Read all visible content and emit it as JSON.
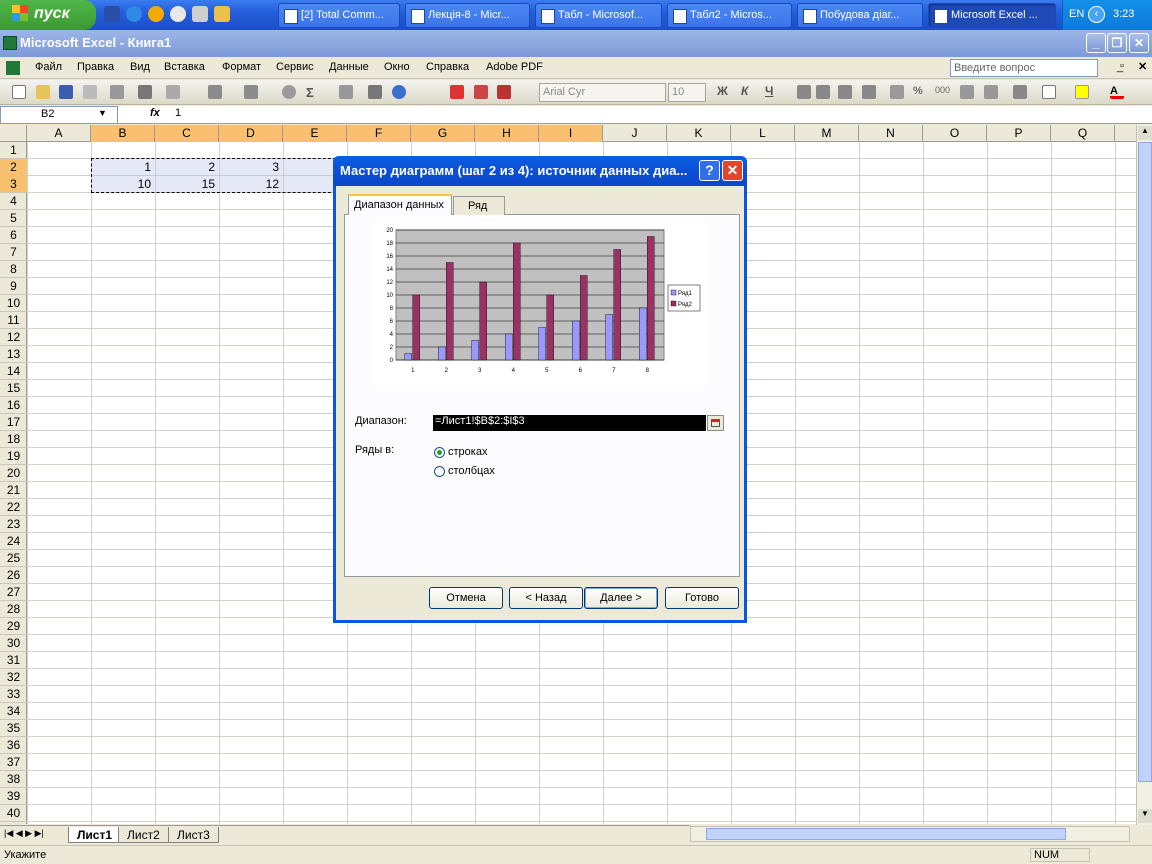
{
  "taskbar": {
    "start_label": "пуск",
    "tasks": [
      "[2] Total Comm...",
      "Лекція-8 - Micr...",
      "Табл - Microsof...",
      "Табл2 - Micros...",
      "Побудова діаг...",
      "Microsoft Excel ..."
    ],
    "lang": "EN",
    "clock": "3:23"
  },
  "window": {
    "title": "Microsoft Excel - Книга1"
  },
  "menu": {
    "items": [
      "Файл",
      "Правка",
      "Вид",
      "Вставка",
      "Формат",
      "Сервис",
      "Данные",
      "Окно",
      "Справка",
      "Adobe PDF"
    ],
    "ask_placeholder": "Введите вопрос"
  },
  "toolbar": {
    "font": "Arial Cyr",
    "size": "10",
    "bold": "Ж",
    "italic": "К",
    "underline": "Ч"
  },
  "formula": {
    "cell": "B2",
    "fx": "fx",
    "value": "1"
  },
  "grid": {
    "columns": [
      "A",
      "B",
      "C",
      "D",
      "E",
      "F",
      "G",
      "H",
      "I",
      "J",
      "K",
      "L",
      "M",
      "N",
      "O",
      "P",
      "Q"
    ],
    "rows": [
      "1",
      "2",
      "3",
      "4",
      "5",
      "6",
      "7",
      "8",
      "9",
      "10",
      "11",
      "12",
      "13",
      "14",
      "15",
      "16",
      "17",
      "18",
      "19",
      "20",
      "21",
      "22",
      "23",
      "24",
      "25",
      "26",
      "27",
      "28",
      "29",
      "30",
      "31",
      "32",
      "33",
      "34",
      "35",
      "36",
      "37",
      "38",
      "39",
      "40"
    ],
    "row2": [
      "1",
      "2",
      "3"
    ],
    "row3": [
      "10",
      "15",
      "12"
    ]
  },
  "sheets": [
    "Лист1",
    "Лист2",
    "Лист3"
  ],
  "status": {
    "left": "Укажите",
    "num": "NUM"
  },
  "dialog": {
    "title": "Мастер диаграмм (шаг 2 из 4): источник данных диа...",
    "help": "?",
    "close": "✕",
    "tab_range": "Диапазон данных",
    "tab_series": "Ряд",
    "range_label": "Диапазон:",
    "range_value": "=Лист1!$B$2:$I$3",
    "series_in_label": "Ряды в:",
    "opt_rows": "строках",
    "opt_cols": "столбцах",
    "btn_cancel": "Отмена",
    "btn_back": "< Назад",
    "btn_next": "Далее >",
    "btn_finish": "Готово"
  },
  "chart_data": {
    "type": "bar",
    "categories": [
      "1",
      "2",
      "3",
      "4",
      "5",
      "6",
      "7",
      "8"
    ],
    "series": [
      {
        "name": "Ряд1",
        "values": [
          1,
          2,
          3,
          4,
          5,
          6,
          7,
          8
        ],
        "color": "#9999ff"
      },
      {
        "name": "Ряд2",
        "values": [
          10,
          15,
          12,
          18,
          10,
          13,
          17,
          19
        ],
        "color": "#993366"
      }
    ],
    "yticks": [
      "0",
      "2",
      "4",
      "6",
      "8",
      "10",
      "12",
      "14",
      "16",
      "18",
      "20"
    ],
    "ylim": [
      0,
      20
    ],
    "plot_bg": "#c0c0c0",
    "grid": true,
    "legend": "right"
  }
}
